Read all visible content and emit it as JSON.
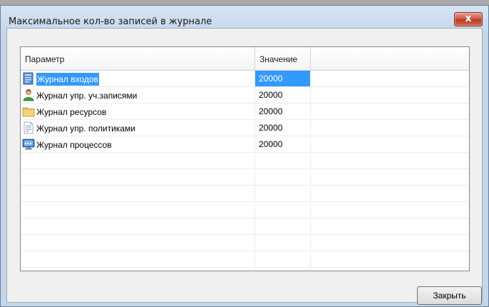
{
  "window": {
    "title": "Максимальное кол-во записей в журнале",
    "close_label": "x"
  },
  "table": {
    "headers": {
      "param": "Параметр",
      "value": "Значение",
      "extra": ""
    },
    "rows": [
      {
        "icon": "login-journal-icon",
        "label": "Журнал входов",
        "value": "20000",
        "selected": true
      },
      {
        "icon": "user-accounts-icon",
        "label": "Журнал упр. уч.записями",
        "value": "20000",
        "selected": false
      },
      {
        "icon": "folder-icon",
        "label": "Журнал ресурсов",
        "value": "20000",
        "selected": false
      },
      {
        "icon": "policy-document-icon",
        "label": "Журнал упр. политиками",
        "value": "20000",
        "selected": false
      },
      {
        "icon": "monitor-process-icon",
        "label": "Журнал процессов",
        "value": "20000",
        "selected": false
      }
    ],
    "empty_rows": 7
  },
  "buttons": {
    "close": "Закрыть"
  },
  "colors": {
    "selection": "#3399ff",
    "title_bar": "#c4d6ea",
    "close_button": "#c9533d"
  }
}
